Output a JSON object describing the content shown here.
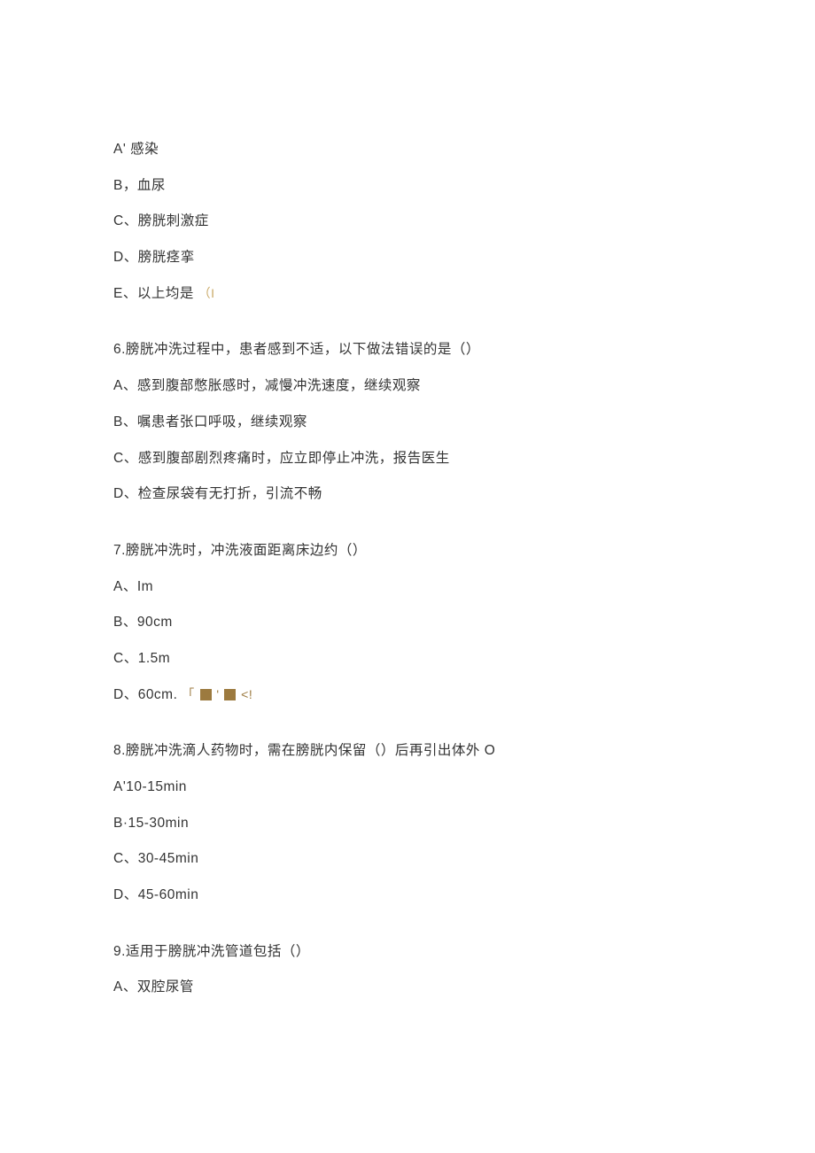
{
  "q5": {
    "optA": "A' 感染",
    "optB": "B，血尿",
    "optC": "C、膀胱刺激症",
    "optD": "D、膀胱痉挛",
    "optE_prefix": "E、以上均是",
    "optE_bracket": "（I"
  },
  "q6": {
    "stem": "6.膀胱冲洗过程中，患者感到不适，以下做法错误的是（）",
    "optA": "A、感到腹部憋胀感时，减慢冲洗速度，继续观察",
    "optB": "B、嘱患者张口呼吸，继续观察",
    "optC": "C、感到腹部剧烈疼痛时，应立即停止冲洗，报告医生",
    "optD": "D、检查尿袋有无打折，引流不畅"
  },
  "q7": {
    "stem": "7.膀胱冲洗时，冲洗液面距离床边约（）",
    "optA": "A、Im",
    "optB": "B、90cm",
    "optC": "C、1.5m",
    "optD_prefix": "D、60cm.",
    "optD_accent1": "「",
    "optD_accent2": "'",
    "optD_accent3": "<!"
  },
  "q8": {
    "stem": "8.膀胱冲洗滴人药物时，需在膀胱内保留（）后再引出体外 O",
    "optA": "A'10-15min",
    "optB": "B·15-30min",
    "optC": "C、30-45min",
    "optD": "D、45-60min"
  },
  "q9": {
    "stem": "9.适用于膀胱冲洗管道包括（）",
    "optA": "A、双腔尿管"
  }
}
